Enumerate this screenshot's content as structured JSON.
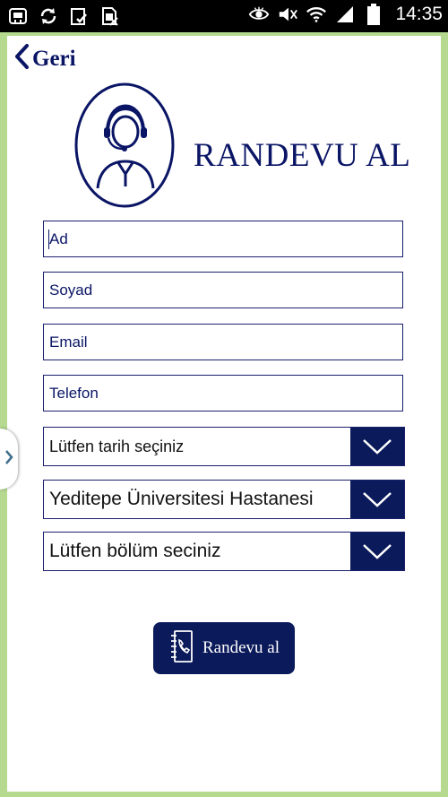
{
  "status_bar": {
    "time": "14:35",
    "icons": [
      "android-debug-icon",
      "sync-icon",
      "clipboard-check-icon",
      "sim-off-icon",
      "eye-icon",
      "mute-icon",
      "wifi-icon",
      "signal-icon",
      "battery-icon"
    ]
  },
  "nav": {
    "back_label": "Geri"
  },
  "header": {
    "title": "RANDEVU AL"
  },
  "form": {
    "first_name_placeholder": "Ad",
    "last_name_placeholder": "Soyad",
    "email_placeholder": "Email",
    "phone_placeholder": "Telefon",
    "date_select": "Lütfen tarih seçiniz",
    "hospital_select": "Yeditepe Üniversitesi Hastanesi",
    "department_select": "Lütfen bölüm seciniz"
  },
  "submit": {
    "label": "Randevu al"
  },
  "colors": {
    "primary": "#0b1a5a",
    "frame": "#b4d98f",
    "text": "#0a1565"
  }
}
